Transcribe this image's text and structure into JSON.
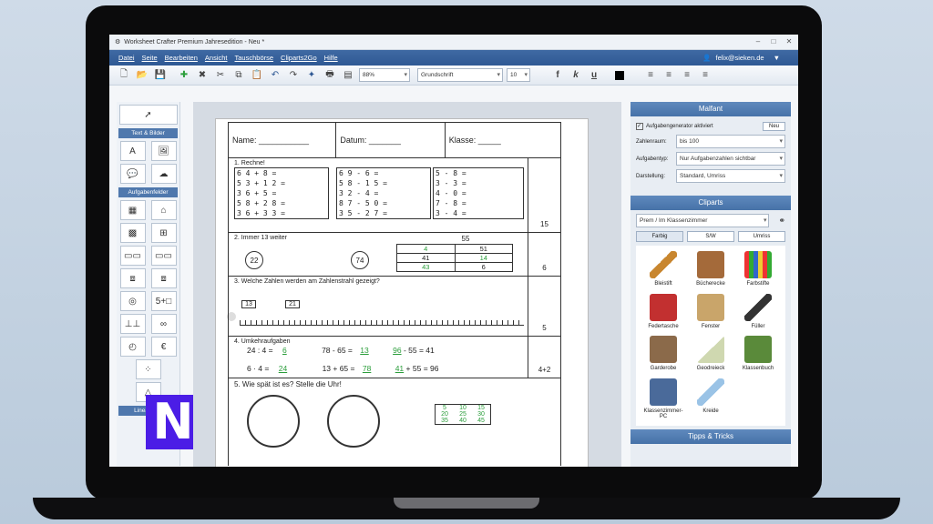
{
  "window": {
    "title": "Worksheet Crafter Premium Jahresedition - Neu *"
  },
  "menu": {
    "items": [
      "Datei",
      "Seite",
      "Bearbeiten",
      "Ansicht",
      "Tauschbörse",
      "Cliparts2Go",
      "Hilfe"
    ],
    "user": "felix@sieken.de"
  },
  "toolbar": {
    "zoom": "88%",
    "font": "Grundschrift",
    "size": "10",
    "bold": "f",
    "italic": "k",
    "underline": "u"
  },
  "left": {
    "sections": [
      "Text & Bilder",
      "Aufgabenfelder",
      "Lineaturen"
    ]
  },
  "doc": {
    "header": {
      "name": "Name: ___________",
      "datum": "Datum: _______",
      "klasse": "Klasse: _____"
    },
    "tasks": [
      {
        "label": "1. Rechne!",
        "points": "15"
      },
      {
        "label": "2. Immer 13 weiter",
        "points": "6"
      },
      {
        "label": "3. Welche Zahlen werden am Zahlenstrahl gezeigt?",
        "points": "5"
      },
      {
        "label": "4. Umkehraufgaben",
        "points": "4+2"
      },
      {
        "label": "5. Wie spät ist es?    Stelle die Uhr!",
        "points": ""
      }
    ],
    "rechne": [
      "6 4 + 8 =",
      "5 3 + 1 2 =",
      "3 6 + 5 =",
      "5 8 + 2 8 =",
      "3 6 + 3 3 ="
    ],
    "rechne2": [
      "6 9 - 6 =",
      "5 8 - 1 5 =",
      "3 2 - 4 =",
      "8 7 - 5 0 =",
      "3 5 - 2 7 ="
    ],
    "rechne3": [
      "5 - 8 =",
      "3 - 3 =",
      "4 - 0 =",
      "7 - 8 =",
      "3 - 4 ="
    ],
    "chain": [
      "22",
      "74"
    ],
    "pyramid": {
      "top": "55",
      "mid": [
        "4",
        "51"
      ],
      "r2": [
        "41",
        "14"
      ],
      "r3": [
        "43",
        "6"
      ]
    },
    "numline": [
      "13",
      "21"
    ],
    "umkehr": [
      [
        "24 : 4 =",
        "6",
        "78 - 65 =",
        "13",
        "96",
        "- 55 = 41"
      ],
      [
        "6 · 4 =",
        "24",
        "13 + 65 =",
        "78",
        "41",
        "+ 55 = 96"
      ]
    ],
    "elephant_grid": [
      "5",
      "10",
      "15",
      "20",
      "25",
      "30",
      "35",
      "40",
      "45"
    ]
  },
  "malfant": {
    "title": "Malfant",
    "checkbox": "Aufgabengenerator aktiviert",
    "new": "Neu",
    "options": [
      {
        "label": "Zahlenraum:",
        "value": "bis 100"
      },
      {
        "label": "Aufgabentyp:",
        "value": "Nur Aufgabenzahlen sichtbar"
      },
      {
        "label": "Darstellung:",
        "value": "Standard, Umriss"
      }
    ]
  },
  "cliparts": {
    "title": "Cliparts",
    "category": "Prem / Im Klassenzimmer",
    "modes": [
      "Farbig",
      "S/W",
      "Umriss"
    ],
    "items": [
      "Bleistift",
      "Bücherecke",
      "Farbstifte",
      "Federtasche",
      "Fenster",
      "Füller",
      "Garderobe",
      "Geodreieck",
      "Klassenbuch",
      "Klassenzimmer-PC",
      "Kreide"
    ]
  },
  "tips": {
    "title": "Tipps & Tricks"
  },
  "colors": {
    "menubar": "#2f5994",
    "panel": "#4672a8",
    "accent": "#4b1de6",
    "green": "#2a9d3a"
  }
}
